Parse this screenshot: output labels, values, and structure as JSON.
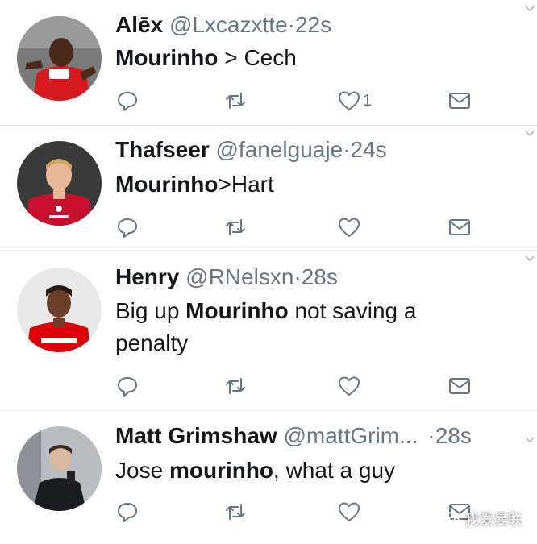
{
  "tweets": [
    {
      "name": "Alēx",
      "handle": "@Lxcazxtte",
      "dot": "·",
      "time": "22s",
      "body": [
        {
          "t": "Mourinho",
          "b": true
        },
        {
          "t": " > Cech",
          "b": false
        }
      ],
      "likes": "1",
      "avatar_colors": {
        "bg": "#7a7a7a",
        "shirt": "#d71920",
        "skin": "#4a2a1a"
      }
    },
    {
      "name": "Thafseer",
      "handle": "@fanelguaje",
      "dot": "·",
      "time": "24s",
      "body": [
        {
          "t": "Mourinho",
          "b": true
        },
        {
          "t": ">Hart",
          "b": false
        }
      ],
      "likes": "",
      "avatar_colors": {
        "bg": "#3a3a3a",
        "shirt": "#c8102e",
        "skin": "#e8b896"
      }
    },
    {
      "name": "Henry",
      "handle": "@RNelsxn",
      "dot": "·",
      "time": "28s",
      "body": [
        {
          "t": "Big up ",
          "b": false
        },
        {
          "t": "Mourinho",
          "b": true
        },
        {
          "t": " not saving a penalty",
          "b": false
        }
      ],
      "likes": "",
      "avatar_colors": {
        "bg": "#e9e9e9",
        "shirt": "#db0007",
        "skin": "#6b3f2a"
      }
    },
    {
      "name": "Matt Grimshaw",
      "handle": "@mattGrim...",
      "dot": "·",
      "time": "28s",
      "body": [
        {
          "t": "Jose ",
          "b": false
        },
        {
          "t": "mourinho",
          "b": true
        },
        {
          "t": ", what a guy",
          "b": false
        }
      ],
      "likes": "",
      "avatar_colors": {
        "bg": "#b9bcc2",
        "shirt": "#1b1b22",
        "skin": "#d9b8a0"
      }
    }
  ],
  "icons": {
    "reply": "reply-icon",
    "retweet": "retweet-icon",
    "like": "heart-icon",
    "dm": "envelope-icon",
    "more": "chevron-down-icon"
  },
  "colors": {
    "icon": "#657786",
    "divider": "#e6ecf0",
    "name": "#14171a"
  },
  "watermark": "我爱曼联"
}
